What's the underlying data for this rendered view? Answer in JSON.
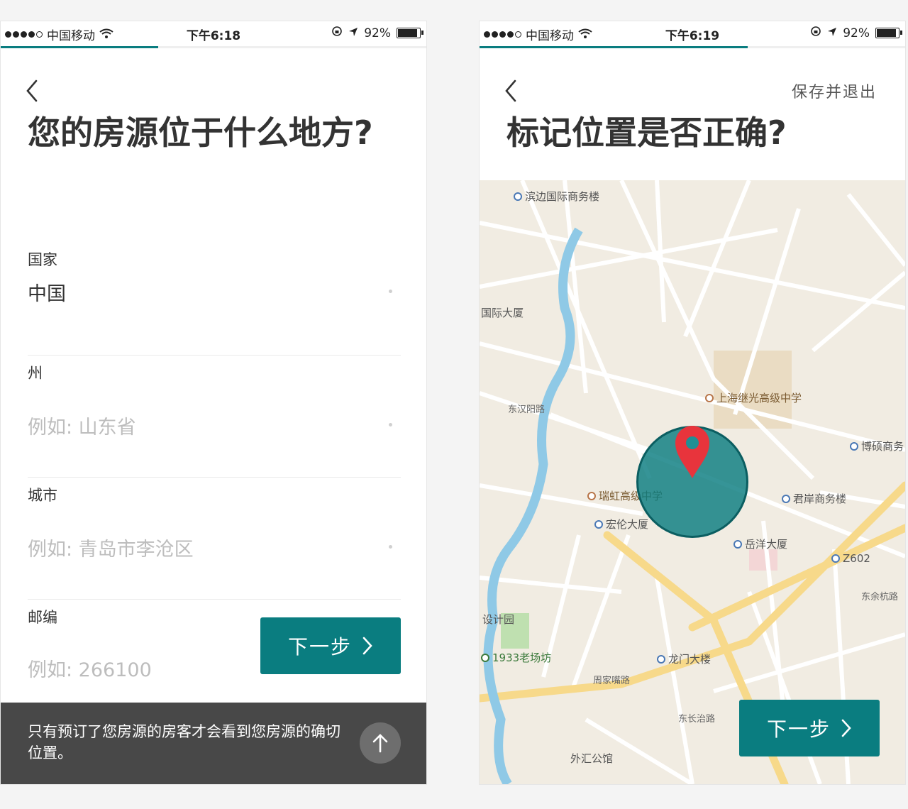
{
  "status_bar_left": {
    "carrier": "中国移动",
    "time": "下午6:18",
    "battery": "92%",
    "battery_level": 0.92
  },
  "status_bar_right": {
    "carrier": "中国移动",
    "time": "下午6:19",
    "battery": "92%",
    "battery_level": 0.92
  },
  "progress_left": 0.37,
  "progress_right": 0.63,
  "location_form": {
    "title": "您的房源位于什么地方?",
    "fields": [
      {
        "label": "国家",
        "value": "中国",
        "placeholder": ""
      },
      {
        "label": "州",
        "value": "",
        "placeholder": "例如: 山东省"
      },
      {
        "label": "城市",
        "value": "",
        "placeholder": "例如: 青岛市李沧区"
      },
      {
        "label": "邮编",
        "value": "",
        "placeholder": "例如: 266100"
      }
    ],
    "next_label": "下一步",
    "tooltip": "只有预订了您房源的房客才会看到您房源的确切位置。"
  },
  "confirm_location": {
    "title": "标记位置是否正确?",
    "save_exit_label": "保存并退出",
    "next_label": "下一步",
    "map": {
      "pois": [
        "滨边国际商务楼",
        "国际大厦",
        "上海继光高级中学",
        "博硕商务",
        "君岸商务楼",
        "瑞虹高级中学",
        "宏伦大厦",
        "岳洋大厦",
        "Z602",
        "设计园",
        "1933老场坊",
        "龙门大楼",
        "外汇公馆"
      ],
      "streets": [
        "东余杭路",
        "周家嘴路",
        "东长治路",
        "东汉阳路"
      ]
    }
  },
  "colors": {
    "accent": "#0a7d80",
    "pin": "#e8343c",
    "tooltip_bg": "#484848",
    "map_land": "#f1ece2",
    "map_water": "#8fc9e6",
    "map_main_road": "#f7d98a"
  }
}
